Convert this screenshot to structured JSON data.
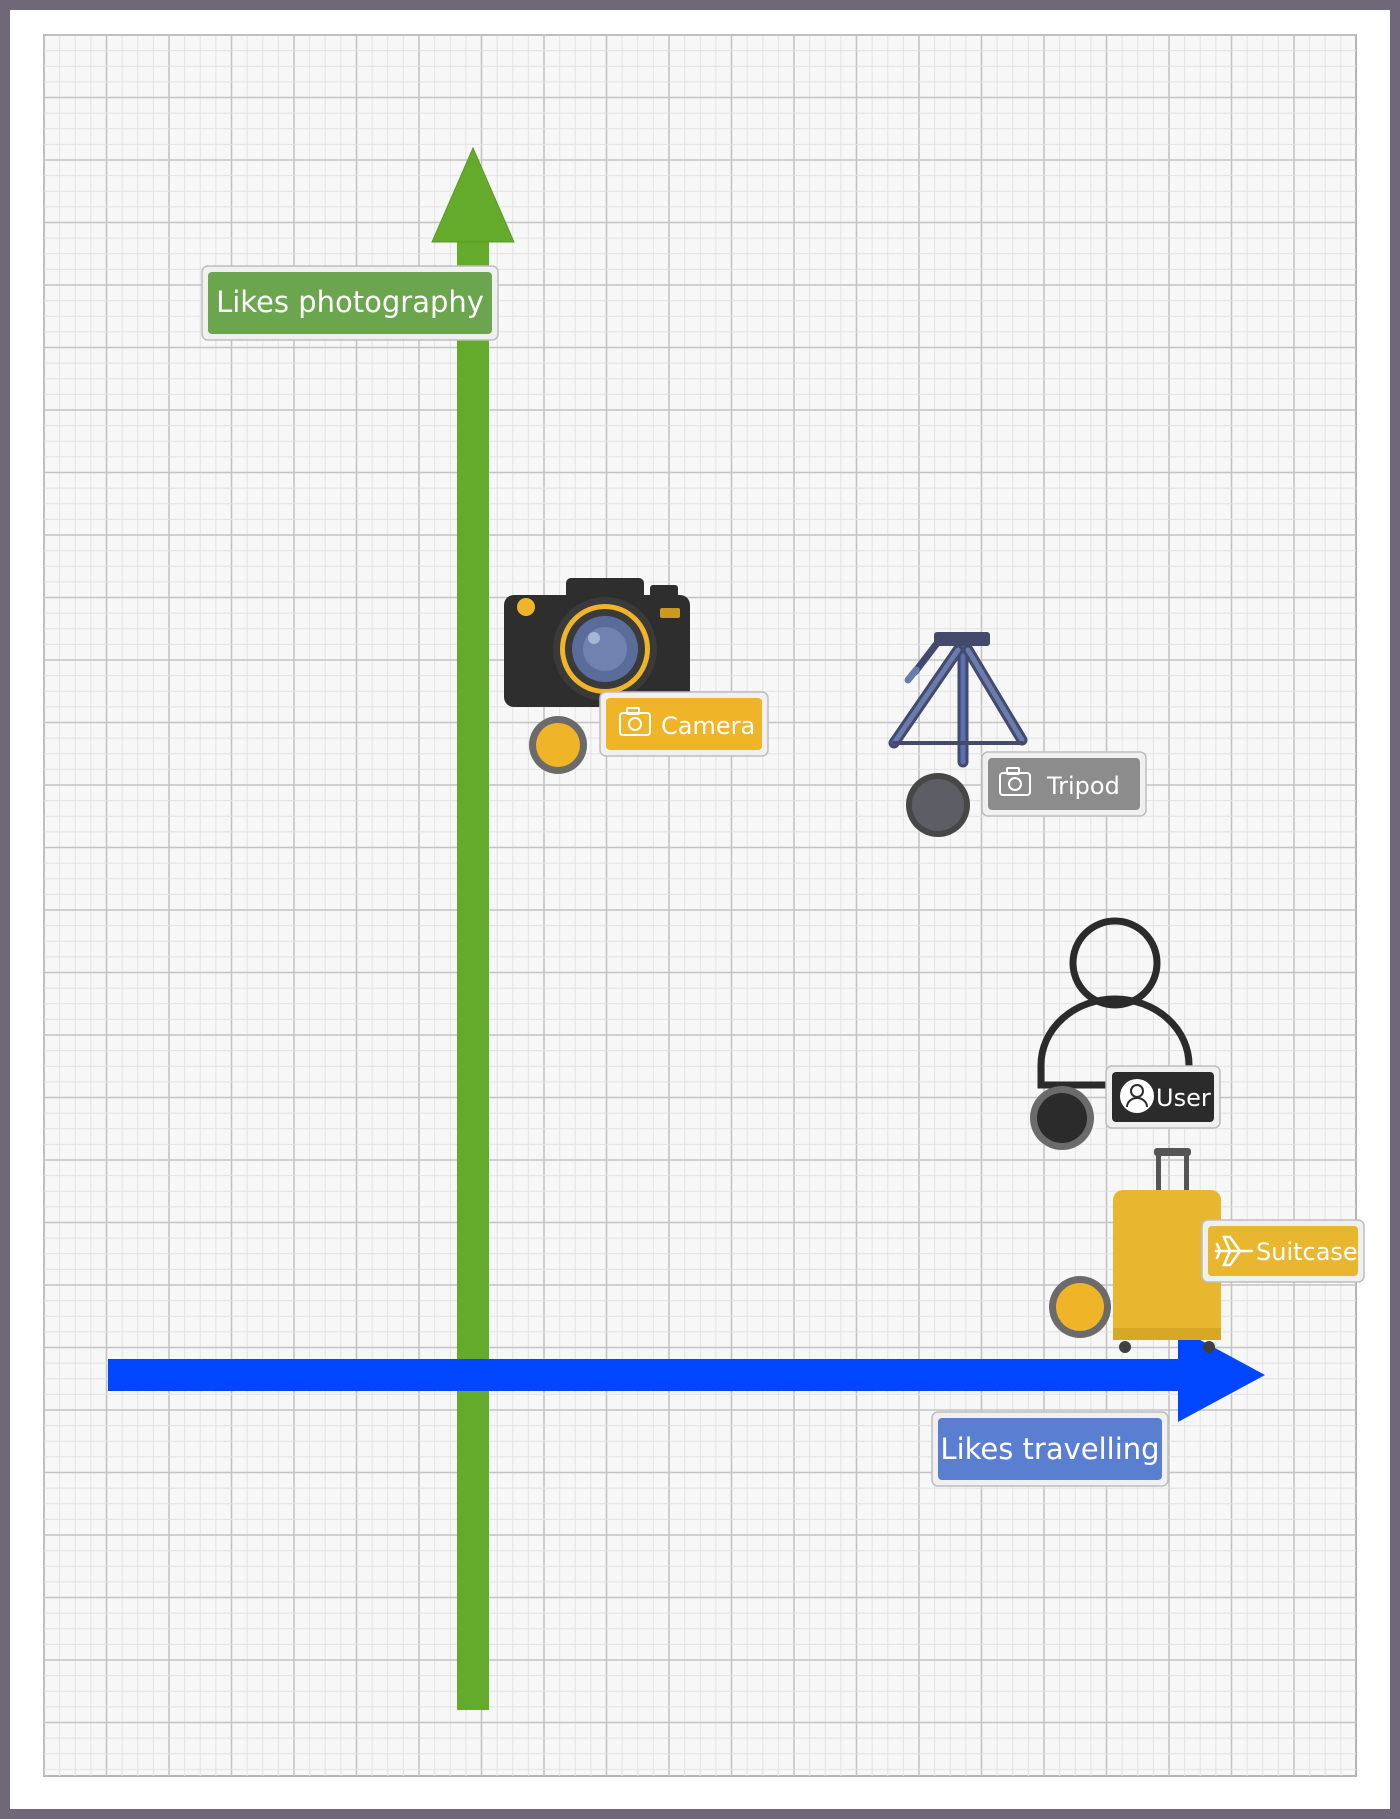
{
  "axes": {
    "y_axis_label": "Likes photography",
    "x_axis_label": "Likes travelling"
  },
  "items": [
    {
      "label": "Camera",
      "icon": "camera-icon",
      "tag_icon": "camera-outline-icon",
      "color": "#f0b429"
    },
    {
      "label": "Tripod",
      "icon": "tripod-icon",
      "tag_icon": "camera-outline-icon",
      "color": "#8c8c8c"
    },
    {
      "label": "User",
      "icon": "user-icon",
      "tag_icon": "user-circle-icon",
      "color": "#2b2b2b"
    },
    {
      "label": "Suitcase",
      "icon": "suitcase-icon",
      "tag_icon": "airplane-icon",
      "color": "#e9b72f"
    }
  ],
  "colors": {
    "y_axis": "#64aa2b",
    "x_axis": "#0046ff",
    "y_label_bg": "#6ba64e",
    "x_label_bg": "#5b7fd0",
    "grid_minor": "#e3e3e3",
    "grid_major": "#c3c3c3"
  }
}
